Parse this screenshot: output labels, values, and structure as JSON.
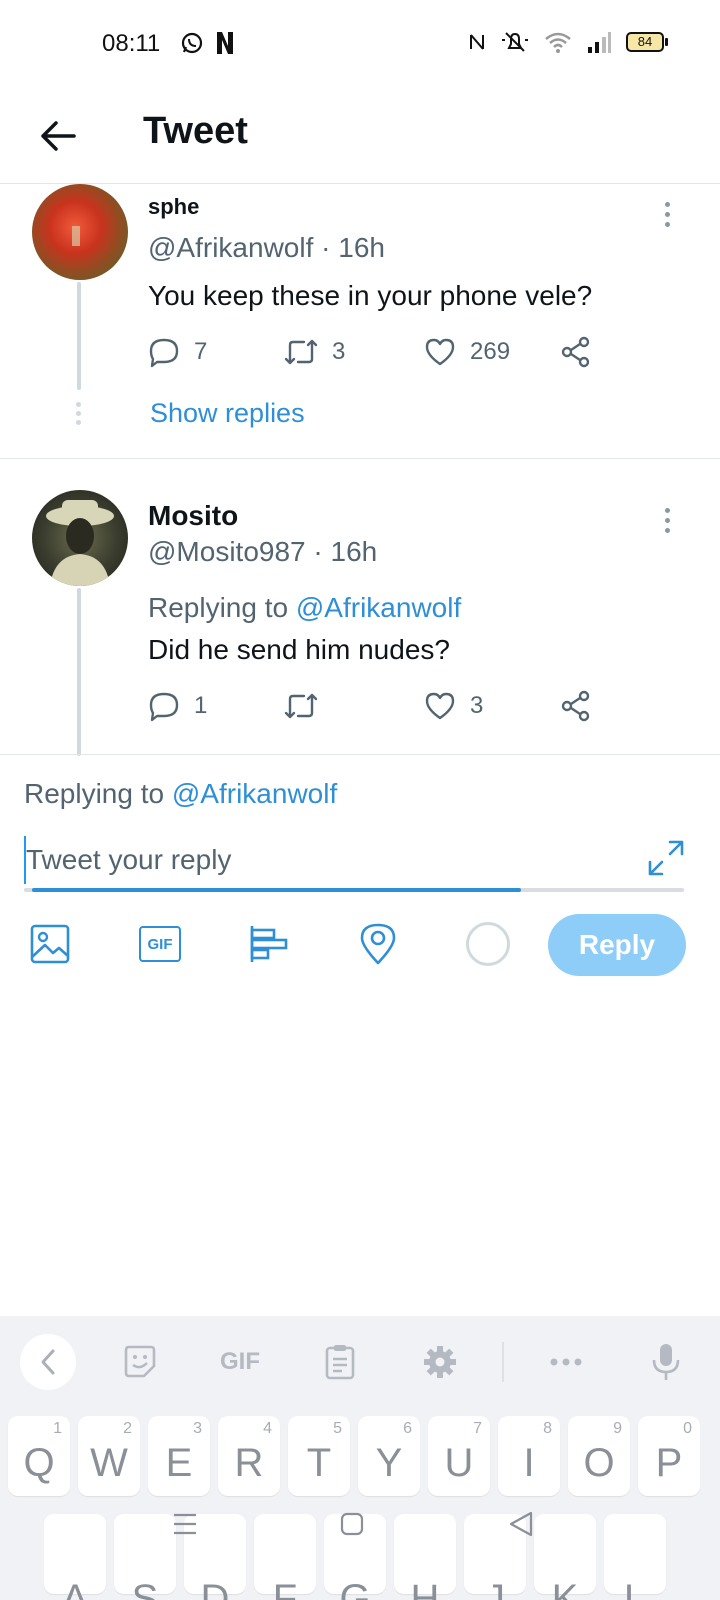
{
  "status_bar": {
    "time": "08:11",
    "battery": "84"
  },
  "header": {
    "title": "Tweet"
  },
  "tweets": [
    {
      "name": "sphe",
      "handle_time": "@Afrikanwolf · 16h",
      "text": "You keep these in your phone vele?",
      "replies": "7",
      "retweets": "3",
      "likes": "269",
      "show_replies": "Show replies"
    },
    {
      "name": "Mosito",
      "handle_time": "@Mosito987 · 16h",
      "replying_prefix": "Replying to",
      "replying_mention": "@Afrikanwolf",
      "text": "Did he send him nudes?",
      "replies": "1",
      "retweets": "",
      "likes": "3"
    }
  ],
  "composer": {
    "replying_prefix": "Replying to",
    "replying_mention": "@Afrikanwolf",
    "placeholder": "Tweet your reply",
    "reply_button": "Reply",
    "gif_label": "GIF",
    "progress": 0.75
  },
  "keyboard": {
    "gif_label": "GIF",
    "row1": [
      {
        "key": "Q",
        "hint": "1"
      },
      {
        "key": "W",
        "hint": "2"
      },
      {
        "key": "E",
        "hint": "3"
      },
      {
        "key": "R",
        "hint": "4"
      },
      {
        "key": "T",
        "hint": "5"
      },
      {
        "key": "Y",
        "hint": "6"
      },
      {
        "key": "U",
        "hint": "7"
      },
      {
        "key": "I",
        "hint": "8"
      },
      {
        "key": "O",
        "hint": "9"
      },
      {
        "key": "P",
        "hint": "0"
      }
    ],
    "row2": [
      "A",
      "S",
      "D",
      "F",
      "G",
      "H",
      "J",
      "K",
      "L"
    ]
  },
  "colors": {
    "accent": "#2f8fd6",
    "reply_button": "#8ecdf8",
    "muted_text": "#536471"
  },
  "icons": [
    "whatsapp-icon",
    "netflix-icon",
    "nfc-icon",
    "mute-icon",
    "wifi-icon",
    "signal-icon",
    "back-arrow-icon",
    "more-icon",
    "reply-icon",
    "retweet-icon",
    "like-icon",
    "share-icon",
    "image-icon",
    "gif-icon",
    "poll-icon",
    "location-icon",
    "expand-icon",
    "sticker-icon",
    "clipboard-icon",
    "settings-icon",
    "microphone-icon"
  ]
}
